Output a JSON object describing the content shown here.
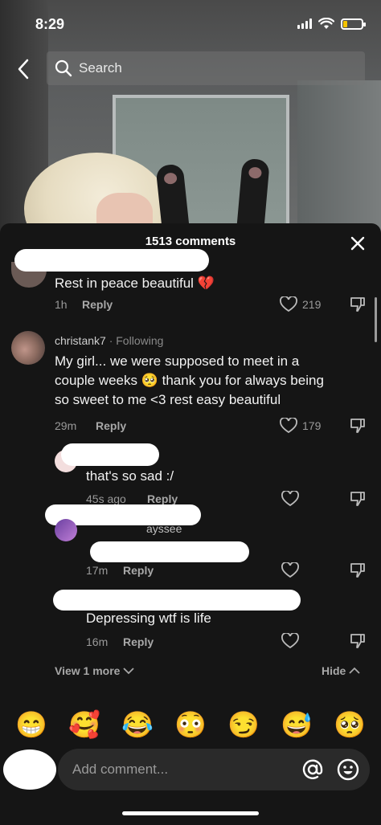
{
  "status_bar": {
    "time": "8:29",
    "battery_color": "#f5c400"
  },
  "header": {
    "search_placeholder": "Search"
  },
  "comments": {
    "count_label": "1513 comments",
    "items": [
      {
        "text": "Rest in peace beautiful 💔",
        "time": "1h",
        "reply_label": "Reply",
        "likes": "219"
      },
      {
        "username": "christank7",
        "following_label": "· Following",
        "text_lines": [
          "My girl... we were supposed to meet in a",
          "couple weeks 🥺 thank you for always being",
          "so sweet to me <3 rest easy beautiful"
        ],
        "time": "29m",
        "reply_label": "Reply",
        "likes": "179"
      },
      {
        "text": "that's so sad :/",
        "time": "45s ago",
        "reply_label": "Reply"
      },
      {
        "username_suffix": "ayssee",
        "time": "17m",
        "reply_label": "Reply"
      },
      {
        "text": "Depressing wtf is life",
        "time": "16m",
        "reply_label": "Reply"
      }
    ],
    "view_more_label": "View 1 more",
    "hide_label": "Hide"
  },
  "emoji_bar": [
    "😁",
    "🥰",
    "😂",
    "😳",
    "😏",
    "😅",
    "🥺"
  ],
  "composer": {
    "placeholder": "Add comment..."
  },
  "colors": {
    "sheet_bg": "#151515",
    "redaction": "#ffffff",
    "muted_text": "#9a9a9a"
  }
}
